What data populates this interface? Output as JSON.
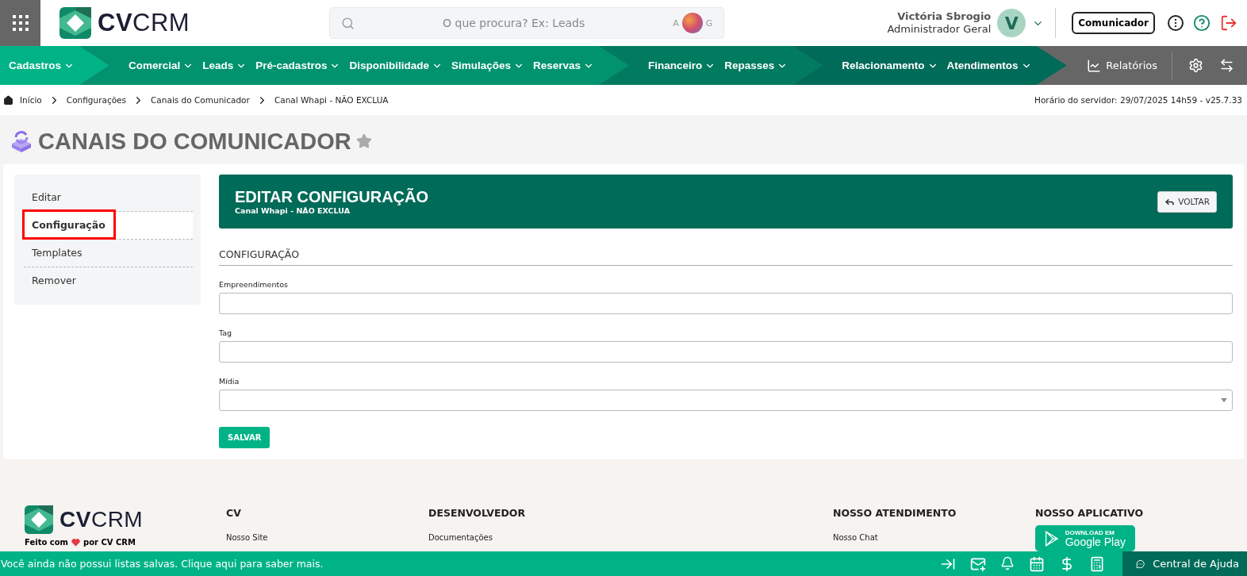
{
  "header": {
    "logo": "**CV**CRM",
    "search": {
      "placeholder": "O que procura? Ex: Leads",
      "shortcut": [
        "A",
        "G"
      ]
    },
    "user": {
      "name": "Victória Sbrogio",
      "role": "Administrador Geral",
      "initial": "V"
    },
    "communicator_button": "Comunicador"
  },
  "nav": {
    "groups": [
      {
        "items": [
          "Cadastros"
        ]
      },
      {
        "items": [
          "Comercial",
          "Leads",
          "Pré-cadastros",
          "Disponibilidade",
          "Simulações",
          "Reservas"
        ]
      },
      {
        "items": [
          "Financeiro",
          "Repasses"
        ]
      },
      {
        "items": [
          "Relacionamento",
          "Atendimentos"
        ]
      }
    ],
    "reports": "Relatórios"
  },
  "breadcrumb": {
    "items": [
      "Início",
      "Configurações",
      "Canais do Comunicador",
      "Canal Whapi - NÃO EXCLUA"
    ],
    "server_time": "Horário do servidor: 29/07/2025 14h59 - v25.7.33"
  },
  "page_title": "CANAIS DO COMUNICADOR",
  "favorite": false,
  "sidebar": {
    "items": [
      {
        "label": "Editar",
        "selected": false
      },
      {
        "label": "Configuração",
        "selected": true
      },
      {
        "label": "Templates",
        "selected": false
      },
      {
        "label": "Remover",
        "selected": false
      }
    ]
  },
  "panel": {
    "title": "EDITAR CONFIGURAÇÃO",
    "subtitle": "Canal Whapi - NÃO EXCLUA",
    "back_button": "VOLTAR",
    "section": "CONFIGURAÇÃO",
    "fields": [
      {
        "label": "Empreendimentos",
        "kind": "text"
      },
      {
        "label": "Tag",
        "kind": "text"
      },
      {
        "label": "Mídia",
        "kind": "select"
      }
    ],
    "save_button": "SALVAR"
  },
  "footer": {
    "logo": "**CV**CRM",
    "made_with": [
      "Feito com",
      "por CV CRM"
    ],
    "columns": [
      {
        "title": "CV",
        "links": [
          "Nosso Site"
        ]
      },
      {
        "title": "DESENVOLVEDOR",
        "links": [
          "Documentações"
        ]
      },
      {
        "title": "NOSSO ATENDIMENTO",
        "links": [
          "Nosso Chat"
        ]
      },
      {
        "title": "NOSSO APLICATIVO",
        "store": {
          "small": "DOWNLOAD EM",
          "big": "Google Play"
        }
      }
    ]
  },
  "bottom_bar": {
    "message": "Você ainda não possui listas salvas. Clique aqui para saber mais.",
    "help": "Central de Ajuda"
  }
}
